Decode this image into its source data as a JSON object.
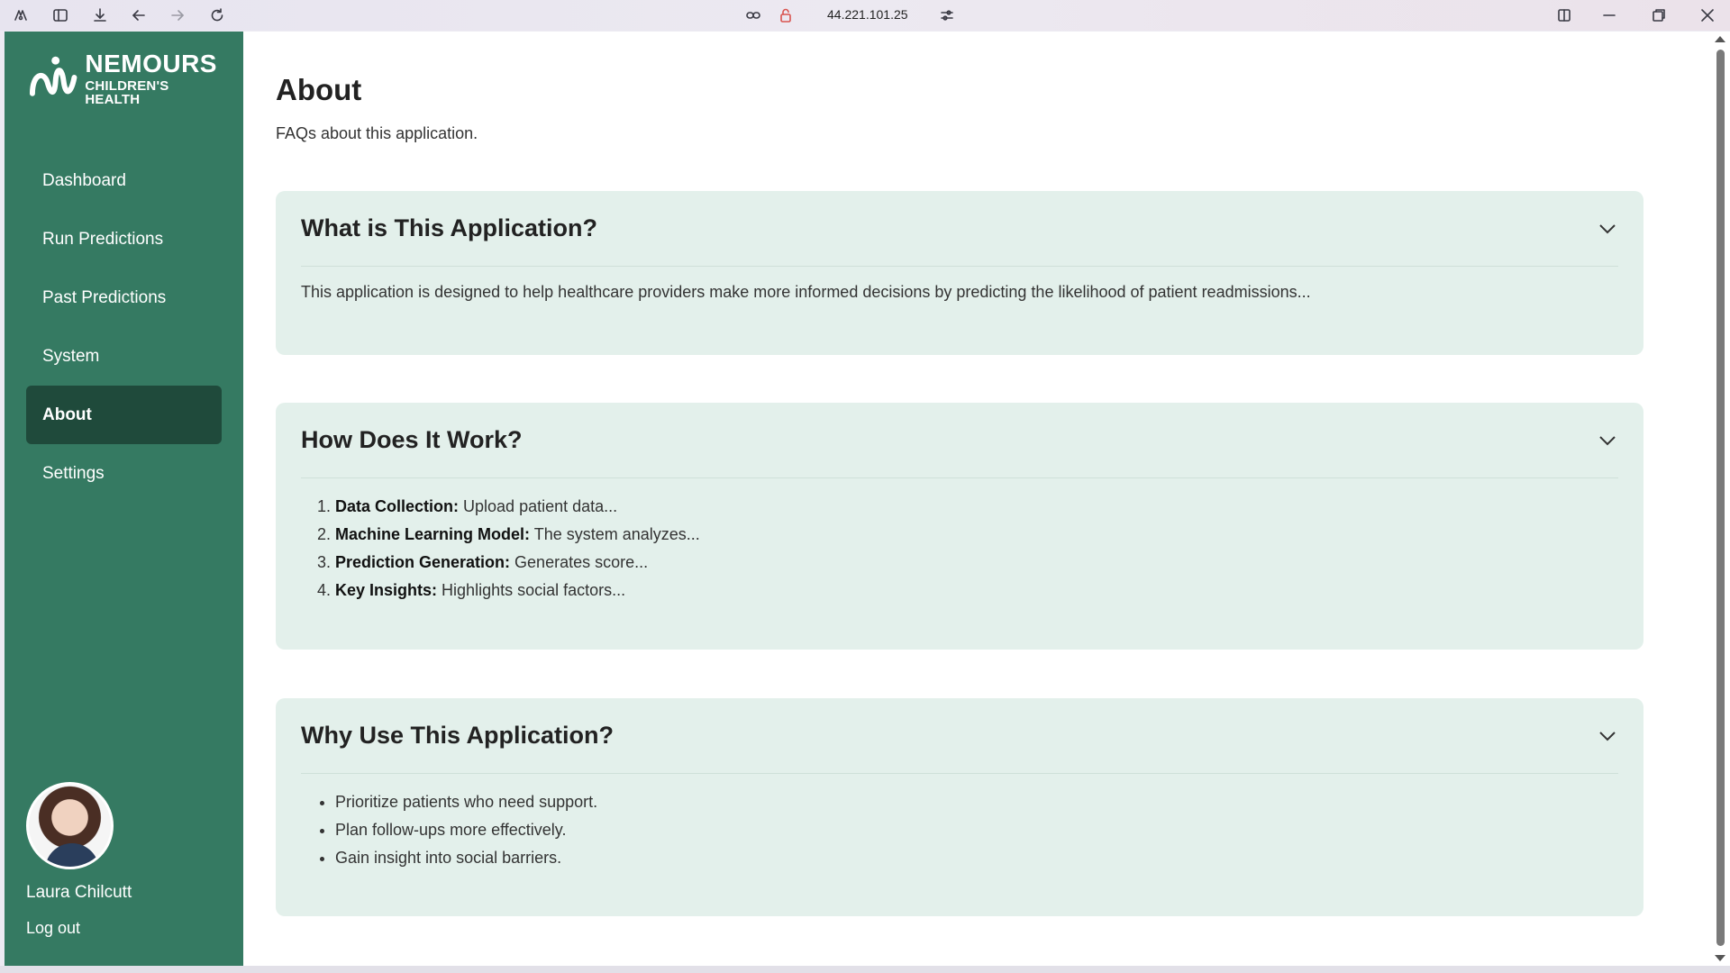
{
  "browser": {
    "url": "44.221.101.25"
  },
  "brand": {
    "name": "NEMOURS",
    "subtitle": "CHILDREN'S HEALTH",
    "sidebar_color": "#357a62",
    "active_color": "#1f4a3b",
    "card_color": "#e3f0eb"
  },
  "nav": {
    "items": [
      {
        "label": "Dashboard"
      },
      {
        "label": "Run Predictions"
      },
      {
        "label": "Past Predictions"
      },
      {
        "label": "System"
      },
      {
        "label": "About",
        "active": true
      },
      {
        "label": "Settings"
      }
    ]
  },
  "user": {
    "name": "Laura Chilcutt",
    "logout_label": "Log out"
  },
  "page": {
    "title": "About",
    "subtitle": "FAQs about this application."
  },
  "faqs": [
    {
      "title": "What is This Application?",
      "body": "This application is designed to help healthcare providers make more informed decisions by predicting the likelihood of patient readmissions..."
    },
    {
      "title": "How Does It Work?",
      "steps": [
        {
          "label": "Data Collection:",
          "text": "Upload patient data..."
        },
        {
          "label": "Machine Learning Model:",
          "text": "The system analyzes..."
        },
        {
          "label": "Prediction Generation:",
          "text": "Generates score..."
        },
        {
          "label": "Key Insights:",
          "text": "Highlights social factors..."
        }
      ]
    },
    {
      "title": "Why Use This Application?",
      "bullets": [
        "Prioritize patients who need support.",
        "Plan follow-ups more effectively.",
        "Gain insight into social barriers."
      ]
    }
  ]
}
